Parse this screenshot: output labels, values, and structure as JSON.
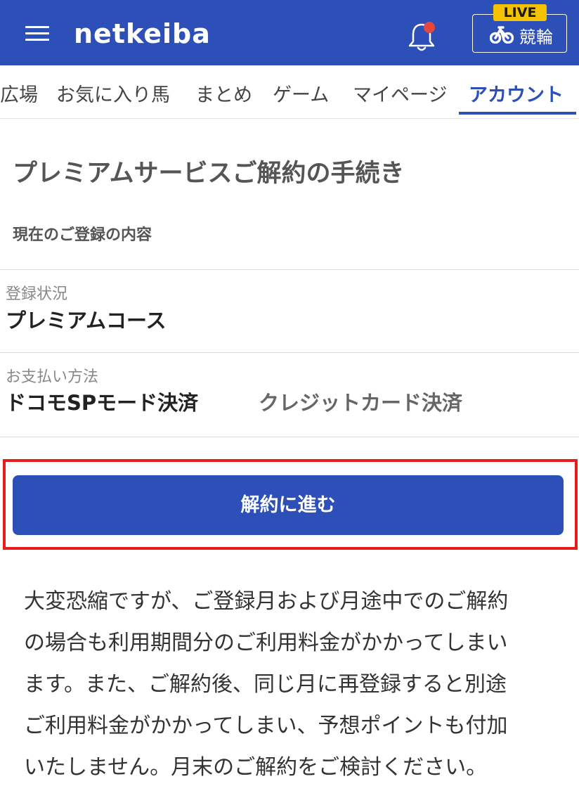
{
  "header": {
    "logo": "netkeiba",
    "live_badge": "LIVE",
    "live_button_label": "競輪"
  },
  "tabs": [
    {
      "label": "広場",
      "active": false
    },
    {
      "label": "お気に入り馬",
      "active": false
    },
    {
      "label": "まとめ",
      "active": false
    },
    {
      "label": "ゲーム",
      "active": false
    },
    {
      "label": "マイページ",
      "active": false
    },
    {
      "label": "アカウント",
      "active": true
    }
  ],
  "main": {
    "title": "プレミアムサービスご解約の手続き",
    "section_label": "現在のご登録の内容",
    "registration": {
      "label": "登録状況",
      "value": "プレミアムコース"
    },
    "payment": {
      "label": "お支払い方法",
      "value": "ドコモSPモード決済",
      "alternate": "クレジットカード決済"
    },
    "cancel_button": "解約に進む",
    "notice_lines": [
      "大変恐縮ですが、ご登録月および月途中でのご解約",
      "の場合も利用期間分のご利用料金がかかってしまい",
      "ます。また、ご解約後、同じ月に再登録すると別途",
      "ご利用料金がかかってしまい、予想ポイントも付加",
      "いたしません。月末のご解約をご検討ください。"
    ]
  },
  "colors": {
    "brand_blue": "#2d4fb8",
    "highlight_red": "#e51d1d",
    "live_yellow": "#f5c200",
    "notification_dot": "#e8453c"
  },
  "icons": [
    "menu-icon",
    "bell-icon",
    "bicycle-icon"
  ]
}
